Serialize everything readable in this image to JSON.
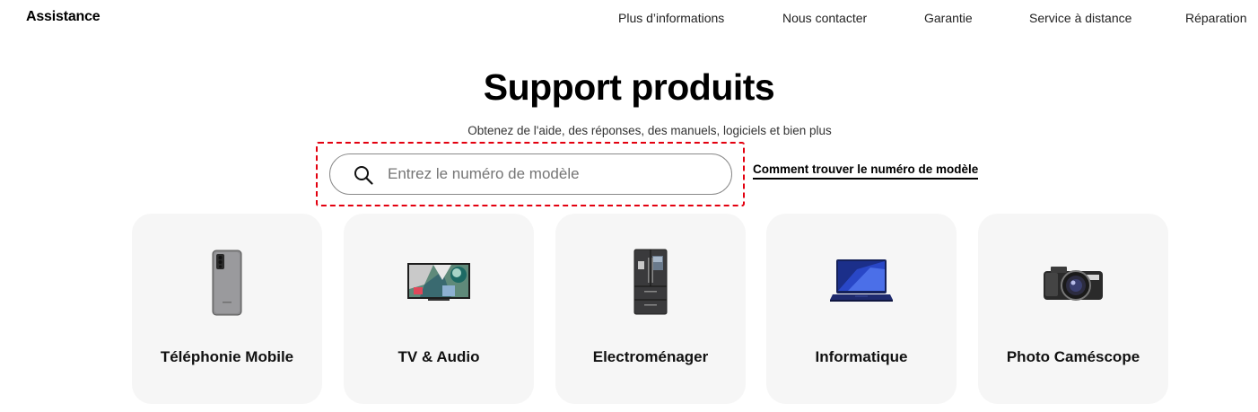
{
  "header": {
    "brand": "Assistance",
    "nav": [
      {
        "label": "Plus d’informations"
      },
      {
        "label": "Nous contacter"
      },
      {
        "label": "Garantie"
      },
      {
        "label": "Service à distance"
      },
      {
        "label": "Réparation"
      }
    ]
  },
  "hero": {
    "title": "Support produits",
    "subtitle": "Obtenez de l'aide, des réponses, des manuels, logiciels et bien plus"
  },
  "search": {
    "placeholder": "Entrez le numéro de modèle",
    "value": "",
    "howto_link": "Comment trouver le numéro de modèle"
  },
  "categories": [
    {
      "label": "Téléphonie Mobile",
      "icon": "smartphone-icon"
    },
    {
      "label": "TV & Audio",
      "icon": "tv-icon"
    },
    {
      "label": "Electroménager",
      "icon": "fridge-icon"
    },
    {
      "label": "Informatique",
      "icon": "laptop-icon"
    },
    {
      "label": "Photo Caméscope",
      "icon": "camera-icon"
    }
  ],
  "colors": {
    "highlight": "#e3000f",
    "card_bg": "#f6f6f6"
  }
}
